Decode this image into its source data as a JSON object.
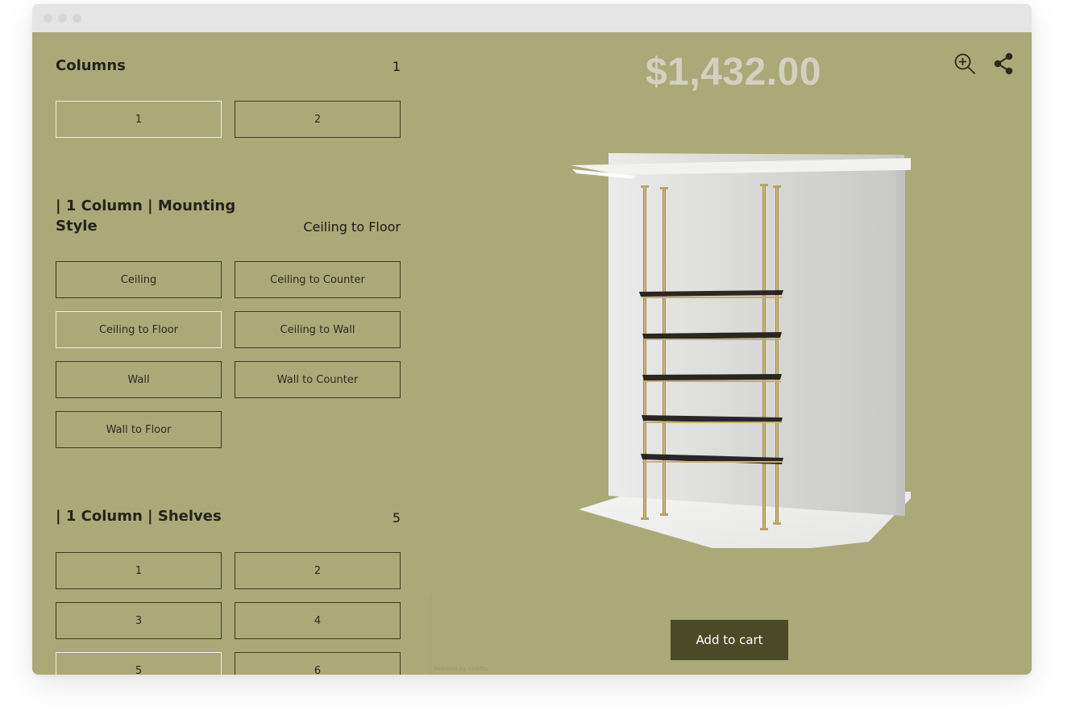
{
  "columns_section": {
    "title": "Columns",
    "value": "1",
    "options": [
      "1",
      "2"
    ]
  },
  "mounting_section": {
    "title": "| 1 Column | Mounting Style",
    "value": "Ceiling to Floor",
    "options": [
      "Ceiling",
      "Ceiling to Counter",
      "Ceiling to Floor",
      "Ceiling to Wall",
      "Wall",
      "Wall to Counter",
      "Wall to Floor"
    ]
  },
  "shelves_section": {
    "title": "| 1 Column | Shelves",
    "value": "5",
    "options": [
      "1",
      "2",
      "3",
      "4",
      "5",
      "6"
    ]
  },
  "viewer": {
    "price": "$1,432.00",
    "add_to_cart": "Add to cart",
    "powered_by": "Powered by Kickflip",
    "zoom_icon": "zoom-in-icon",
    "share_icon": "share-icon"
  },
  "colors": {
    "background": "#aba978",
    "button_border": "#3b3b26",
    "selected_border": "#eeeee4",
    "cart_button": "#4a4b26",
    "price": "#d3d1be"
  }
}
